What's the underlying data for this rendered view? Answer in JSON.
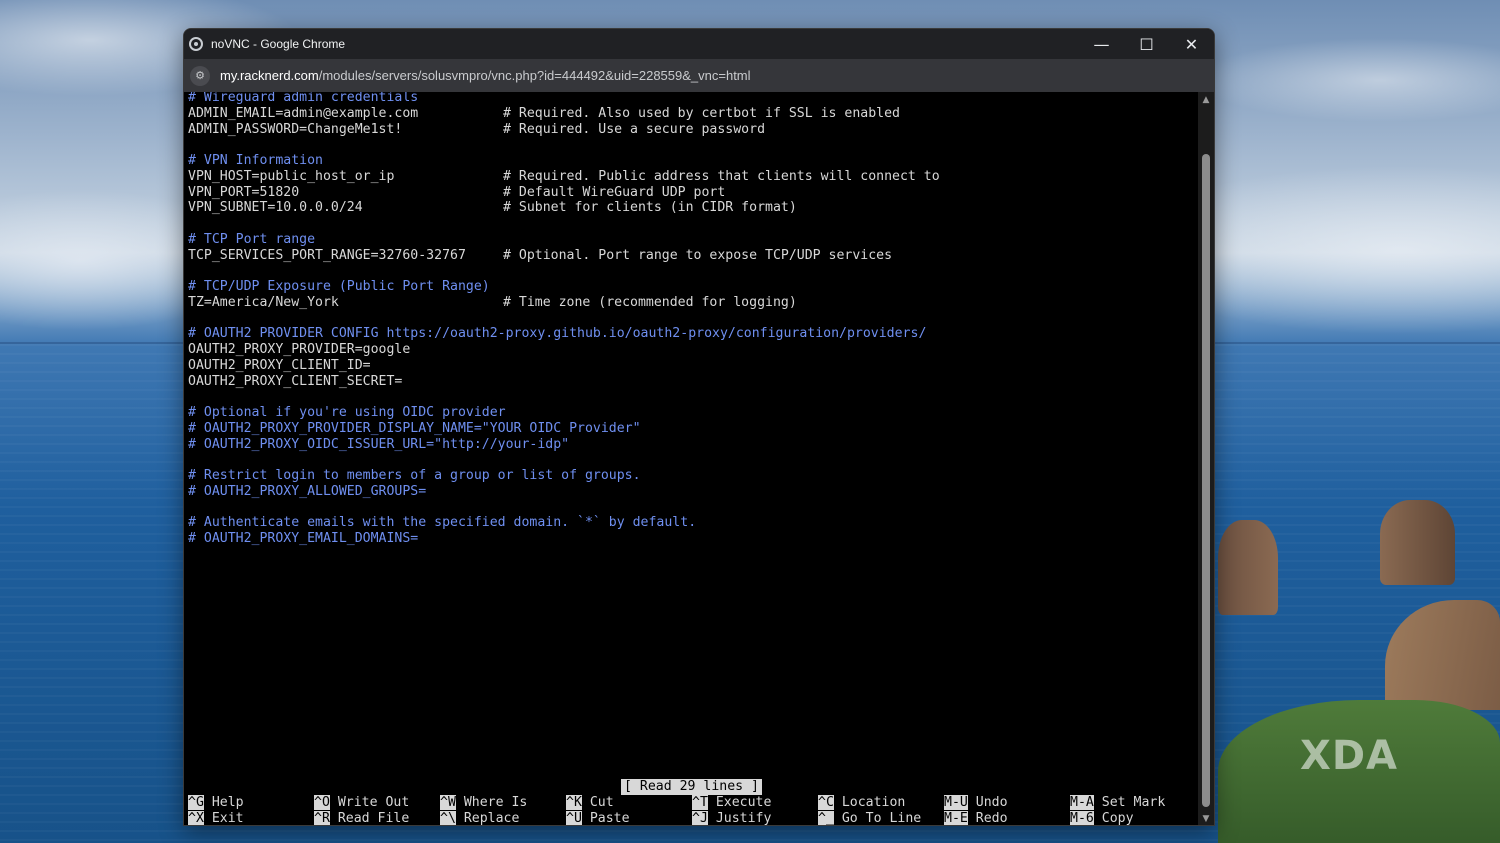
{
  "window": {
    "title": "noVNC - Google Chrome",
    "controls": {
      "minimize": "—",
      "maximize": "☐",
      "close": "✕"
    }
  },
  "address": {
    "host": "my.racknerd.com",
    "path": "/modules/servers/solusvmpro/vnc.php?id=444492&uid=228559&_vnc=html"
  },
  "terminal": {
    "lines": [
      {
        "type": "comment",
        "text": "# Wireguard admin credentials"
      },
      {
        "type": "kv",
        "key": "ADMIN_EMAIL=admin@example.com",
        "comment": "# Required. Also used by certbot if SSL is enabled"
      },
      {
        "type": "kv",
        "key": "ADMIN_PASSWORD=ChangeMe1st!",
        "comment": "# Required. Use a secure password"
      },
      {
        "type": "blank"
      },
      {
        "type": "comment",
        "text": "# VPN Information"
      },
      {
        "type": "kv",
        "key": "VPN_HOST=public_host_or_ip",
        "comment": "# Required. Public address that clients will connect to"
      },
      {
        "type": "kv",
        "key": "VPN_PORT=51820",
        "comment": "# Default WireGuard UDP port"
      },
      {
        "type": "kv",
        "key": "VPN_SUBNET=10.0.0.0/24",
        "comment": "# Subnet for clients (in CIDR format)"
      },
      {
        "type": "blank"
      },
      {
        "type": "comment",
        "text": "# TCP Port range"
      },
      {
        "type": "kv",
        "key": "TCP_SERVICES_PORT_RANGE=32760-32767",
        "comment": "# Optional. Port range to expose TCP/UDP services"
      },
      {
        "type": "blank"
      },
      {
        "type": "comment",
        "text": "# TCP/UDP Exposure (Public Port Range)"
      },
      {
        "type": "kv",
        "key": "TZ=America/New_York",
        "comment": "# Time zone (recommended for logging)"
      },
      {
        "type": "blank"
      },
      {
        "type": "comment",
        "text": "# OAUTH2 PROVIDER CONFIG https://oauth2-proxy.github.io/oauth2-proxy/configuration/providers/"
      },
      {
        "type": "plain",
        "text": "OAUTH2_PROXY_PROVIDER=google"
      },
      {
        "type": "plain",
        "text": "OAUTH2_PROXY_CLIENT_ID="
      },
      {
        "type": "plain",
        "text": "OAUTH2_PROXY_CLIENT_SECRET="
      },
      {
        "type": "blank"
      },
      {
        "type": "comment",
        "text": "# Optional if you're using OIDC provider"
      },
      {
        "type": "comment",
        "text": "# OAUTH2_PROXY_PROVIDER_DISPLAY_NAME=\"YOUR OIDC Provider\""
      },
      {
        "type": "comment",
        "text": "# OAUTH2_PROXY_OIDC_ISSUER_URL=\"http://your-idp\""
      },
      {
        "type": "blank"
      },
      {
        "type": "comment",
        "text": "# Restrict login to members of a group or list of groups."
      },
      {
        "type": "comment",
        "text": "# OAUTH2_PROXY_ALLOWED_GROUPS="
      },
      {
        "type": "blank"
      },
      {
        "type": "comment",
        "text": "# Authenticate emails with the specified domain. `*` by default."
      },
      {
        "type": "comment",
        "text": "# OAUTH2_PROXY_EMAIL_DOMAINS="
      }
    ],
    "status_message": "[ Read 29 lines ]",
    "shortcuts_row1": [
      {
        "key": "^G",
        "label": "Help"
      },
      {
        "key": "^O",
        "label": "Write Out"
      },
      {
        "key": "^W",
        "label": "Where Is"
      },
      {
        "key": "^K",
        "label": "Cut"
      },
      {
        "key": "^T",
        "label": "Execute"
      },
      {
        "key": "^C",
        "label": "Location"
      },
      {
        "key": "M-U",
        "label": "Undo"
      },
      {
        "key": "M-A",
        "label": "Set Mark"
      }
    ],
    "shortcuts_row2": [
      {
        "key": "^X",
        "label": "Exit"
      },
      {
        "key": "^R",
        "label": "Read File"
      },
      {
        "key": "^\\",
        "label": "Replace"
      },
      {
        "key": "^U",
        "label": "Paste"
      },
      {
        "key": "^J",
        "label": "Justify"
      },
      {
        "key": "^_",
        "label": "Go To Line"
      },
      {
        "key": "M-E",
        "label": "Redo"
      },
      {
        "key": "M-6",
        "label": "Copy"
      }
    ]
  },
  "watermark": "XDA",
  "colors": {
    "comment": "#6f8ff0",
    "text": "#d8d8d8",
    "terminal_bg": "#000000",
    "titlebar": "#202124",
    "addressbar": "#35363a"
  }
}
